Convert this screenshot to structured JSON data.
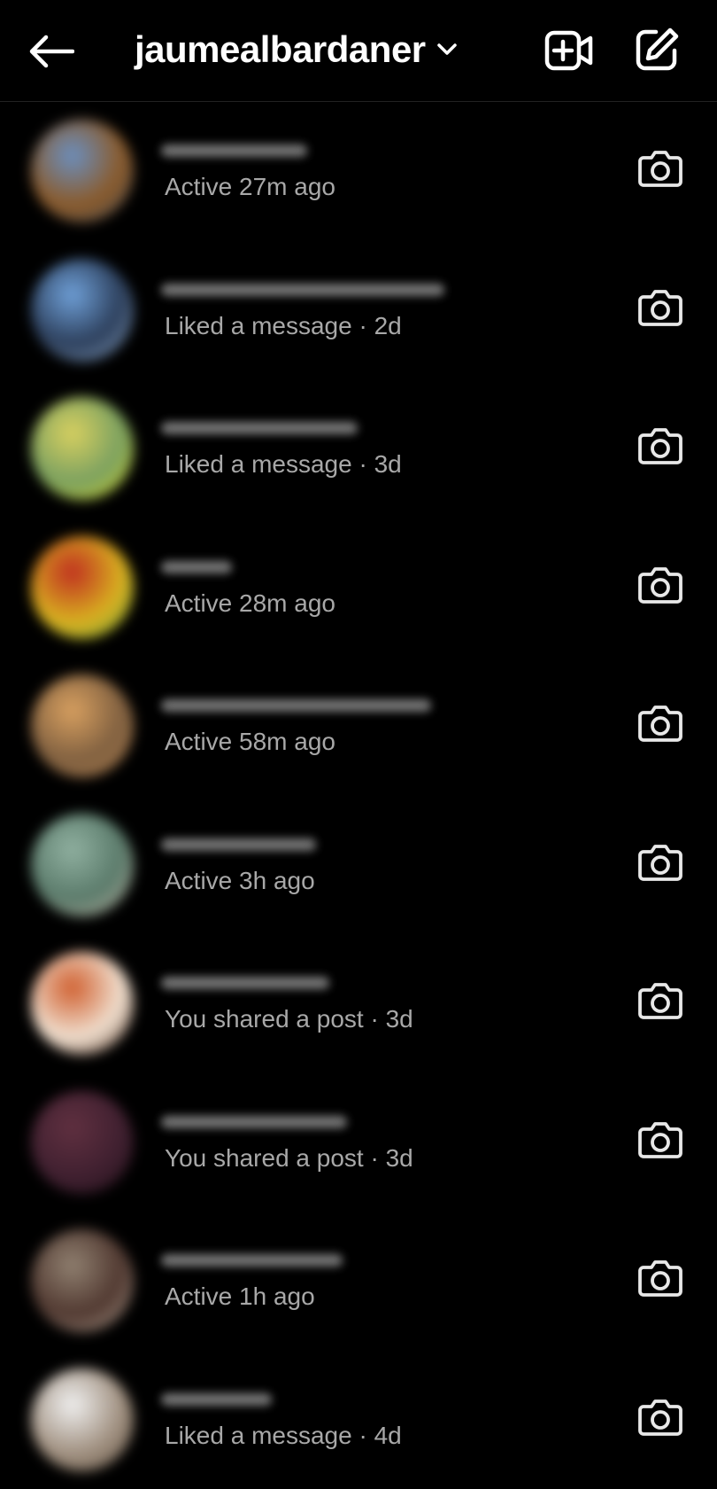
{
  "header": {
    "title": "jaumealbardaner",
    "back_icon": "arrow-left-icon",
    "chevron_icon": "chevron-down-icon",
    "video_icon": "new-video-call-icon",
    "compose_icon": "compose-icon"
  },
  "conversations": [
    {
      "status": "Active 27m ago",
      "avatar_colors": [
        "#6b8fbf",
        "#8a5a2a",
        "#3e4a5a"
      ]
    },
    {
      "status": "Liked a message · 2d",
      "avatar_colors": [
        "#6fa0d8",
        "#2c3e5a",
        "#9ab7d8"
      ]
    },
    {
      "status": "Liked a message · 3d",
      "avatar_colors": [
        "#d8d060",
        "#7aa060",
        "#e8e020"
      ]
    },
    {
      "status": "Active 28m ago",
      "avatar_colors": [
        "#c03020",
        "#d8b020",
        "#60a040"
      ]
    },
    {
      "status": "Active 58m ago",
      "avatar_colors": [
        "#d8a060",
        "#806040",
        "#b08050"
      ]
    },
    {
      "status": "Active 3h ago",
      "avatar_colors": [
        "#90b0a0",
        "#5a7a6a",
        "#d0c0b0"
      ]
    },
    {
      "status": "You shared a post · 3d",
      "avatar_colors": [
        "#d06030",
        "#f0e0d0",
        "#402010"
      ]
    },
    {
      "status": "You shared a post · 3d",
      "avatar_colors": [
        "#603040",
        "#402030",
        "#201018"
      ]
    },
    {
      "status": "Active 1h ago",
      "avatar_colors": [
        "#908070",
        "#503830",
        "#c0b0a0"
      ]
    },
    {
      "status": "Liked a message · 4d",
      "avatar_colors": [
        "#f0f0f0",
        "#a09080",
        "#605040"
      ]
    }
  ],
  "row_icon": "camera-icon"
}
